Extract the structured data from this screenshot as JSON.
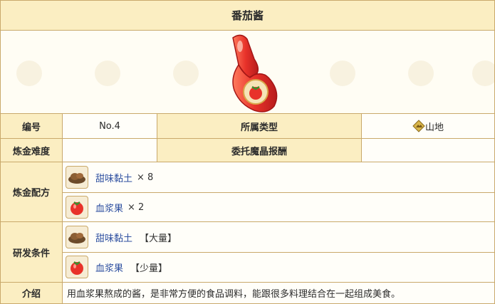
{
  "title": "番茄酱",
  "info": {
    "number_label": "编号",
    "number_value": "No.4",
    "type_label": "所属类型",
    "type_value": "山地",
    "difficulty_label": "炼金难度",
    "difficulty_value": "",
    "reward_label": "委托魔晶报酬",
    "reward_value": ""
  },
  "recipe": {
    "label": "炼金配方",
    "items": [
      {
        "name": "甜味黏土",
        "qty": "× 8",
        "icon": "clay-icon"
      },
      {
        "name": "血浆果",
        "qty": "× 2",
        "icon": "berry-icon"
      }
    ]
  },
  "research": {
    "label": "研发条件",
    "items": [
      {
        "name": "甜味黏土",
        "amount": "【大量】",
        "icon": "clay-icon"
      },
      {
        "name": "血浆果",
        "amount": "【少量】",
        "icon": "berry-icon"
      }
    ]
  },
  "intro": {
    "label": "介绍",
    "text": "用血浆果熬成的酱，是非常方便的食品调料，能跟很多料理结合在一起组成美食。"
  },
  "colors": {
    "header_bg": "#fbeec2",
    "border": "#c9a96b",
    "link": "#2d4fa0",
    "sauce_red": "#e8322a"
  }
}
